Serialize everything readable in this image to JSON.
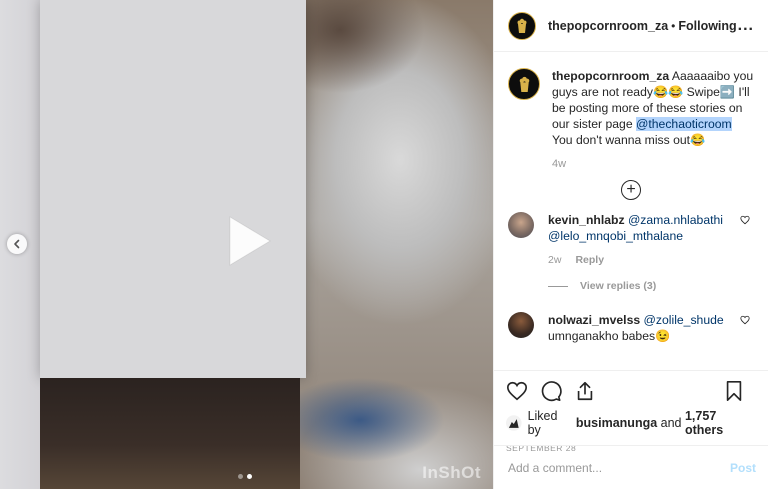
{
  "media": {
    "watermark": "InShOt",
    "carousel_dots": 2,
    "active_dot": 1
  },
  "header": {
    "username": "thepopcornroom_za",
    "separator": "•",
    "follow_status": "Following",
    "more": "..."
  },
  "caption": {
    "username": "thepopcornroom_za",
    "text_1": " Aaaaaaibo you guys are not ready😂😂 Swipe➡️ I'll be posting more of these stories on our sister page ",
    "mention": "@thechaoticroom",
    "text_2": " You don't wanna miss out😂",
    "age": "4w"
  },
  "load_more": "+",
  "comments": [
    {
      "username": "kevin_nhlabz",
      "mention_1": "@zama.nhlabathi",
      "mention_2": "@lelo_mnqobi_mthalane",
      "age": "2w",
      "reply_label": "Reply",
      "view_replies": "View replies (3)"
    },
    {
      "username": "nolwazi_mvelss",
      "mention_1": "@zolile_shude",
      "text": "umnganakho babes😉"
    }
  ],
  "likes": {
    "prefix": "Liked by ",
    "user": "busimanunga",
    "middle": " and ",
    "count": "1,757 others"
  },
  "date": "September 28",
  "add_comment": {
    "placeholder": "Add a comment...",
    "post_label": "Post"
  },
  "colors": {
    "link": "#003569",
    "highlight": "#b3d4fc",
    "post_disabled": "#b2dffc"
  }
}
